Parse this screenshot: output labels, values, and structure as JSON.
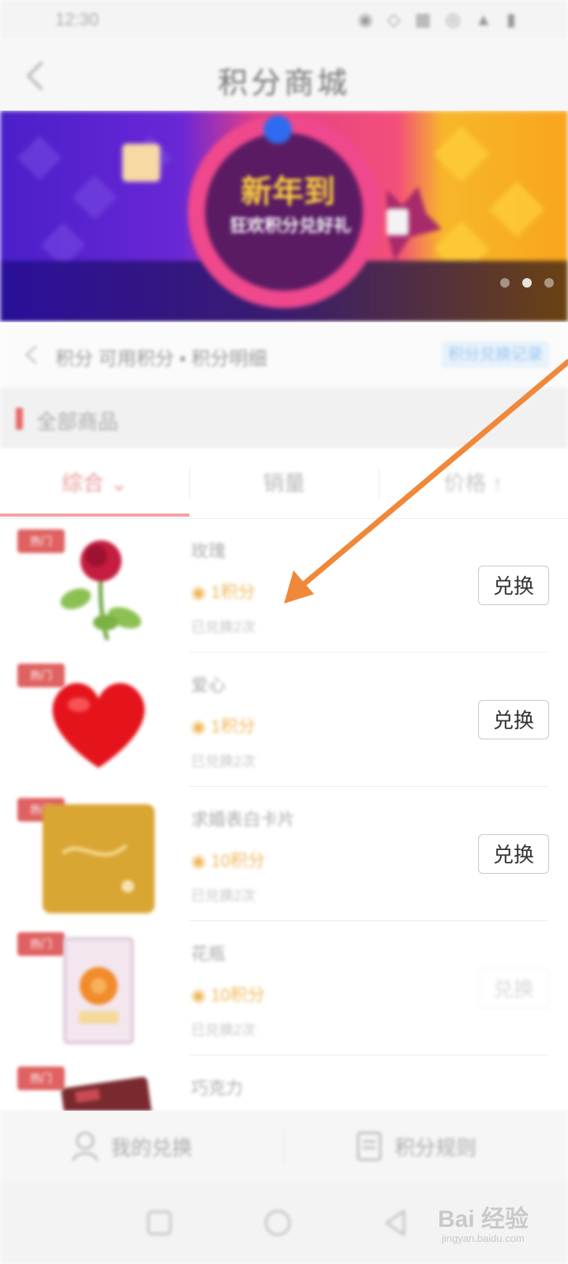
{
  "status_bar": {
    "time": "12:30",
    "icons": "◉ ◇ ▦ ◎ ▲ ▮"
  },
  "header": {
    "title": "积分商城"
  },
  "banner": {
    "headline": "新年到",
    "subline": "狂欢积分兑好礼"
  },
  "info_row": {
    "text": "积分  可用积分 • 积分明细",
    "link": "积分兑换记录"
  },
  "section": {
    "title": "全部商品"
  },
  "sort_tabs": [
    {
      "label": "综合 ⌄"
    },
    {
      "label": "销量"
    },
    {
      "label": "价格 ↑"
    }
  ],
  "products": [
    {
      "badge": "热门",
      "name": "玫瑰",
      "price": "◉ 1积分",
      "stock": "已兑换2次",
      "action": "兑换",
      "icon": "rose-icon"
    },
    {
      "badge": "热门",
      "name": "爱心",
      "price": "◉ 1积分",
      "stock": "已兑换2次",
      "action": "兑换",
      "icon": "heart-icon"
    },
    {
      "badge": "热门",
      "name": "求婚表白卡片",
      "price": "◉ 10积分",
      "stock": "已兑换2次",
      "action": "兑换",
      "icon": "card-icon"
    },
    {
      "badge": "热门",
      "name": "花瓶",
      "price": "◉ 10积分",
      "stock": "已兑换2次",
      "action": "兑换",
      "icon": "flower-card-icon"
    },
    {
      "badge": "热门",
      "name": "巧克力",
      "price": "",
      "stock": "",
      "action": "",
      "icon": "chocolate-icon"
    }
  ],
  "bottom_bar": {
    "left": "我的兑换",
    "right": "积分规则"
  },
  "watermark": {
    "text": "Bai 经验",
    "url": "jingyan.baidu.com"
  },
  "colors": {
    "annotation_arrow": "#f0883a",
    "accent_red": "#e06161",
    "price_gold": "#f0b75a"
  }
}
